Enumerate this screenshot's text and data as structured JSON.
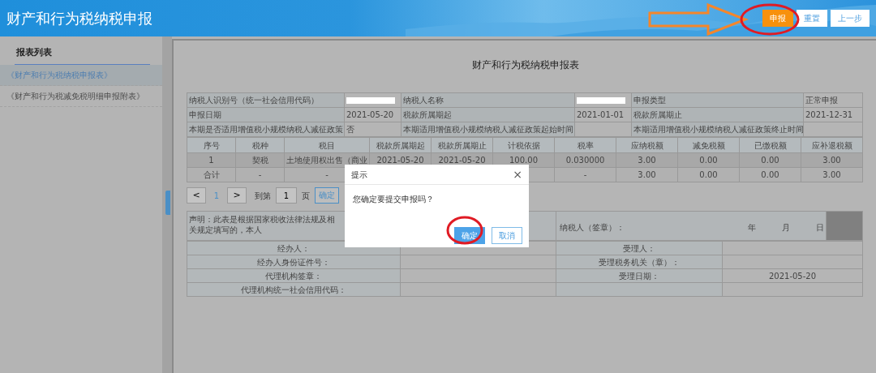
{
  "header": {
    "title": "财产和行为税纳税申报",
    "buttons": [
      {
        "label": "申报",
        "kind": "primary"
      },
      {
        "label": "重置",
        "kind": "default"
      },
      {
        "label": "上一步",
        "kind": "default"
      }
    ]
  },
  "sidebar": {
    "heading": "报表列表",
    "items": [
      {
        "label": "《财产和行为税纳税申报表》",
        "selected": true
      },
      {
        "label": "《财产和行为税减免税明细申报附表》",
        "selected": false
      }
    ]
  },
  "form": {
    "title": "财产和行为税纳税申报表",
    "info_rows": [
      [
        {
          "kind": "label",
          "text": "纳税人识别号（统一社会信用代码）"
        },
        {
          "kind": "redacted"
        },
        {
          "kind": "label",
          "text": "纳税人名称"
        },
        {
          "kind": "redacted"
        },
        {
          "kind": "label",
          "text": "申报类型"
        },
        {
          "kind": "value",
          "text": "正常申报"
        }
      ],
      [
        {
          "kind": "label",
          "text": "申报日期"
        },
        {
          "kind": "value",
          "text": "2021-05-20"
        },
        {
          "kind": "label",
          "text": "税款所属期起"
        },
        {
          "kind": "value",
          "text": "2021-01-01"
        },
        {
          "kind": "label",
          "text": "税款所属期止"
        },
        {
          "kind": "value",
          "text": "2021-12-31"
        }
      ],
      [
        {
          "kind": "label",
          "text": "本期是否适用增值税小规模纳税人减征政策"
        },
        {
          "kind": "value",
          "text": "否"
        },
        {
          "kind": "label",
          "text": "本期适用增值税小规模纳税人减征政策起始时间"
        },
        {
          "kind": "value"
        },
        {
          "kind": "label",
          "text": "本期适用增值税小规模纳税人减征政策终止时间"
        },
        {
          "kind": "value"
        }
      ]
    ],
    "table": {
      "columns": [
        "序号",
        "税种",
        "税目",
        "税款所属期起",
        "税款所属期止",
        "计税依据",
        "税率",
        "应纳税额",
        "减免税额",
        "已缴税额",
        "应补退税额"
      ],
      "rows": [
        {
          "kind": "item",
          "cells": [
            "1",
            "契税",
            "土地使用权出售（商业",
            "2021-05-20",
            "2021-05-20",
            "100.00",
            "0.030000",
            "3.00",
            "0.00",
            "0.00",
            "3.00"
          ]
        },
        {
          "kind": "total",
          "cells": [
            "合计",
            "-",
            "-",
            null,
            null,
            null,
            "-",
            "3.00",
            "0.00",
            "0.00",
            "3.00"
          ]
        }
      ]
    },
    "pagination": {
      "prev": "<",
      "page": "1",
      "next": ">",
      "goto_label": "到第",
      "goto_value": "1",
      "page_unit": "页",
      "confirm": "确定"
    },
    "declaration": {
      "text": "声明：此表是根据国家税收法律法规及相关规定填写的，本人",
      "signer_label": "纳税人（签章）：",
      "date_parts": [
        "年",
        "月",
        "日"
      ]
    },
    "sign_rows": [
      [
        {
          "label": "经办人："
        },
        {
          "label": "受理人："
        }
      ],
      [
        {
          "label": "经办人身份证件号："
        },
        {
          "label": "受理税务机关（章）："
        }
      ],
      [
        {
          "label": "代理机构签章："
        },
        {
          "label": "受理日期：",
          "value": "2021-05-20"
        }
      ],
      [
        {
          "label": "代理机构统一社会信用代码："
        },
        {}
      ]
    ]
  },
  "dialog": {
    "title": "提示",
    "close": "×",
    "message": "您确定要提交申报吗？",
    "buttons": [
      {
        "label": "确定",
        "kind": "primary"
      },
      {
        "label": "取消",
        "kind": "default"
      }
    ]
  }
}
